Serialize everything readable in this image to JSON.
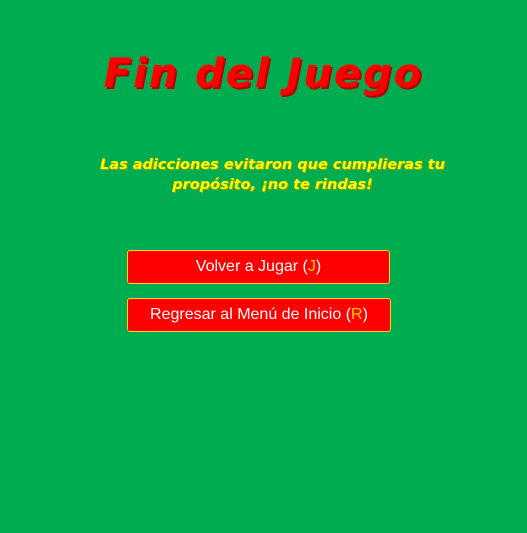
{
  "screen": {
    "title": "Fin del Juego",
    "message": "Las adicciones evitaron que cumplieras tu propósito, ¡no te rindas!"
  },
  "buttons": {
    "play_again": {
      "label": "Volver a Jugar",
      "open_paren": "(",
      "key": "J",
      "close_paren": ")"
    },
    "main_menu": {
      "label": "Regresar al Menú de Inicio",
      "open_paren": "(",
      "key": "R",
      "close_paren": ")"
    }
  },
  "colors": {
    "background": "#00ac50",
    "title": "#ff0000",
    "message": "#ffff00",
    "button_bg": "#ff0000",
    "button_border": "#ffd200",
    "button_text": "#ffffff",
    "hotkey": "#ffd200"
  }
}
